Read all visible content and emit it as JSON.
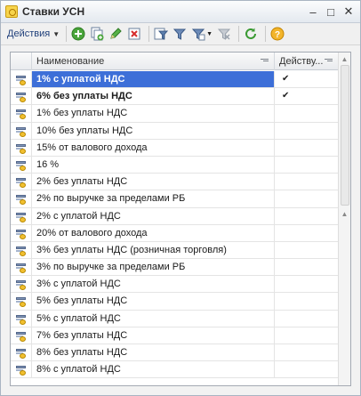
{
  "window": {
    "title": "Ставки УСН",
    "icon": "app-icon",
    "buttons": [
      "minimize-icon",
      "maximize-icon",
      "close-icon"
    ]
  },
  "toolbar": {
    "actions_label": "Действия",
    "buttons": [
      "add-icon",
      "copy-icon",
      "edit-icon",
      "delete-icon",
      "filter-icon",
      "filter-by-value-icon",
      "filter-list-icon",
      "clear-filter-icon",
      "refresh-icon",
      "help-icon"
    ]
  },
  "table": {
    "columns": [
      "Наименование",
      "Действу..."
    ],
    "rows": [
      {
        "name": "1% с уплатой НДС",
        "active": true,
        "selected": true,
        "bold": true
      },
      {
        "name": "6% без уплаты НДС",
        "active": true,
        "selected": false,
        "bold": true
      },
      {
        "name": "1% без уплаты НДС",
        "active": false
      },
      {
        "name": "10% без уплаты НДС",
        "active": false
      },
      {
        "name": "15% от валового дохода",
        "active": false
      },
      {
        "name": "16 %",
        "active": false
      },
      {
        "name": "2% без уплаты НДС",
        "active": false
      },
      {
        "name": "2% по выручке за пределами РБ",
        "active": false
      },
      {
        "name": "2% с уплатой НДС",
        "active": false
      },
      {
        "name": "20% от валового дохода",
        "active": false
      },
      {
        "name": "3% без уплаты НДС (розничная торговля)",
        "active": false
      },
      {
        "name": "3% по выручке за пределами РБ",
        "active": false
      },
      {
        "name": "3% с уплатой НДС",
        "active": false
      },
      {
        "name": "5% без уплаты НДС",
        "active": false
      },
      {
        "name": "5% с уплатой НДС",
        "active": false
      },
      {
        "name": "7% без уплаты НДС",
        "active": false
      },
      {
        "name": "8% без уплаты НДС",
        "active": false
      },
      {
        "name": "8% с уплатой НДС",
        "active": false
      }
    ]
  },
  "colors": {
    "selection": "#3d6fd8",
    "accent": "#1f3f7a"
  }
}
